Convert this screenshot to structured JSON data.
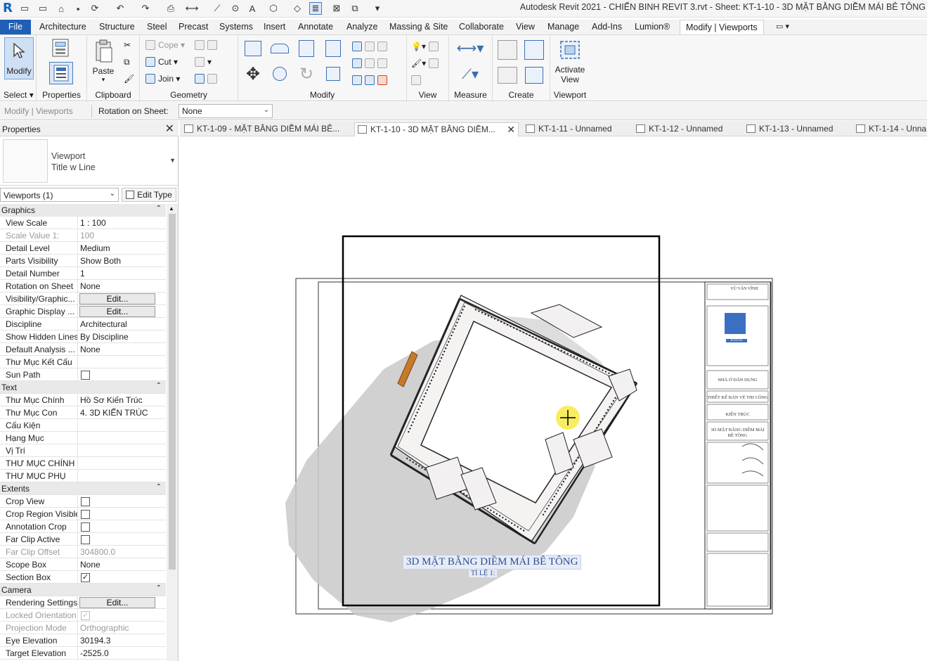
{
  "titlebar": {
    "app_logo": "R",
    "window_title": "Autodesk Revit 2021 - CHIẾN BINH REVIT 3.rvt - Sheet: KT-1-10 - 3D MẶT BẰNG DIỀM MÁI BÊ TÔNG",
    "quick_access_icons": [
      "open-icon",
      "save-icon",
      "sync-icon",
      "undo-icon",
      "redo-icon",
      "print-icon",
      "measure-icon",
      "tag-icon",
      "text-icon",
      "3d-view-icon",
      "section-icon",
      "thin-lines-icon",
      "close-hidden-icon",
      "switch-windows-icon",
      "customize-icon"
    ]
  },
  "ribbon_tabs": [
    "File",
    "Architecture",
    "Structure",
    "Steel",
    "Precast",
    "Systems",
    "Insert",
    "Annotate",
    "Analyze",
    "Massing & Site",
    "Collaborate",
    "View",
    "Manage",
    "Add-Ins",
    "Lumion®",
    "Modify | Viewports"
  ],
  "ribbon": {
    "select": {
      "modify_label": "Modify",
      "panel_label": "Select"
    },
    "properties": {
      "panel_label": "Properties"
    },
    "clipboard": {
      "paste_label": "Paste",
      "panel_label": "Clipboard"
    },
    "geometry": {
      "cope_label": "Cope",
      "cut_label": "Cut",
      "join_label": "Join",
      "panel_label": "Geometry"
    },
    "modify": {
      "panel_label": "Modify"
    },
    "view": {
      "panel_label": "View"
    },
    "measure": {
      "panel_label": "Measure"
    },
    "create": {
      "panel_label": "Create"
    },
    "viewport": {
      "activate_label_1": "Activate",
      "activate_label_2": "View",
      "panel_label": "Viewport"
    }
  },
  "options_bar": {
    "context": "Modify | Viewports",
    "rotation_label": "Rotation on Sheet:",
    "rotation_value": "None"
  },
  "properties": {
    "title": "Properties",
    "type_family": "Viewport",
    "type_name": "Title w Line",
    "instance_filter": "Viewports (1)",
    "edit_type": "Edit Type",
    "groups": [
      {
        "name": "Graphics",
        "rows": [
          {
            "name": "View Scale",
            "value": "1 : 100"
          },
          {
            "name": "Scale Value    1:",
            "value": "100",
            "readonly": true
          },
          {
            "name": "Detail Level",
            "value": "Medium"
          },
          {
            "name": "Parts Visibility",
            "value": "Show Both"
          },
          {
            "name": "Detail Number",
            "value": "1"
          },
          {
            "name": "Rotation on Sheet",
            "value": "None"
          },
          {
            "name": "Visibility/Graphic...",
            "button": "Edit..."
          },
          {
            "name": "Graphic Display ...",
            "button": "Edit..."
          },
          {
            "name": "Discipline",
            "value": "Architectural"
          },
          {
            "name": "Show Hidden Lines",
            "value": "By Discipline"
          },
          {
            "name": "Default Analysis ...",
            "value": "None"
          },
          {
            "name": "Thư Mục Kết Cấu",
            "value": ""
          },
          {
            "name": "Sun Path",
            "checkbox": false
          }
        ]
      },
      {
        "name": "Text",
        "rows": [
          {
            "name": "Thư Mục Chính",
            "value": "Hồ Sơ Kiến Trúc"
          },
          {
            "name": "Thư Mục Con",
            "value": "4. 3D KIẾN TRÚC"
          },
          {
            "name": "Cấu Kiện",
            "value": ""
          },
          {
            "name": "Hạng Mục",
            "value": ""
          },
          {
            "name": "Vị Trí",
            "value": ""
          },
          {
            "name": "THƯ MỤC CHÍNH",
            "value": ""
          },
          {
            "name": "THƯ MỤC PHỤ",
            "value": ""
          }
        ]
      },
      {
        "name": "Extents",
        "rows": [
          {
            "name": "Crop View",
            "checkbox": false
          },
          {
            "name": "Crop Region Visible",
            "checkbox": false
          },
          {
            "name": "Annotation Crop",
            "checkbox": false
          },
          {
            "name": "Far Clip Active",
            "checkbox": false
          },
          {
            "name": "Far Clip Offset",
            "value": "304800.0",
            "readonly": true
          },
          {
            "name": "Scope Box",
            "value": "None"
          },
          {
            "name": "Section Box",
            "checkbox": true
          }
        ]
      },
      {
        "name": "Camera",
        "rows": [
          {
            "name": "Rendering Settings",
            "button": "Edit..."
          },
          {
            "name": "Locked Orientation",
            "checkbox": true,
            "readonly": true
          },
          {
            "name": "Projection Mode",
            "value": "Orthographic",
            "readonly": true
          },
          {
            "name": "Eye Elevation",
            "value": "30194.3"
          },
          {
            "name": "Target Elevation",
            "value": "-2525.0"
          }
        ]
      }
    ]
  },
  "view_tabs": [
    {
      "label": "KT-1-09 - MẶT BẰNG DIỀM MÁI BÊ...",
      "active": false
    },
    {
      "label": "KT-1-10 - 3D MẶT BẰNG DIỀM...",
      "active": true
    },
    {
      "label": "KT-1-11 - Unnamed",
      "active": false
    },
    {
      "label": "KT-1-12 - Unnamed",
      "active": false
    },
    {
      "label": "KT-1-13 - Unnamed",
      "active": false
    },
    {
      "label": "KT-1-14 - Unna",
      "active": false
    }
  ],
  "sheet": {
    "view_title": "3D MẶT BẰNG DIỀM MÁI BÊ TÔNG",
    "view_title_sub": "TỈ LỆ 1:",
    "titleblock": {
      "owner": "VŨ VĂN VĨNH",
      "logo_text": "K'SSTO",
      "project": "NHÀ Ở DÂN DỤNG",
      "stage": "THIẾT KẾ BẢN VẼ THI CÔNG",
      "discipline": "KIẾN TRÚC",
      "sheet_title": "3D MẶT BẰNG DIỀM MÁI BÊ TÔNG"
    }
  },
  "colors": {
    "file_tab": "#1f5fb7",
    "title_blue": "#2f4e94",
    "shadow": "#c8c8c8",
    "roof": "#f5f2f2"
  }
}
